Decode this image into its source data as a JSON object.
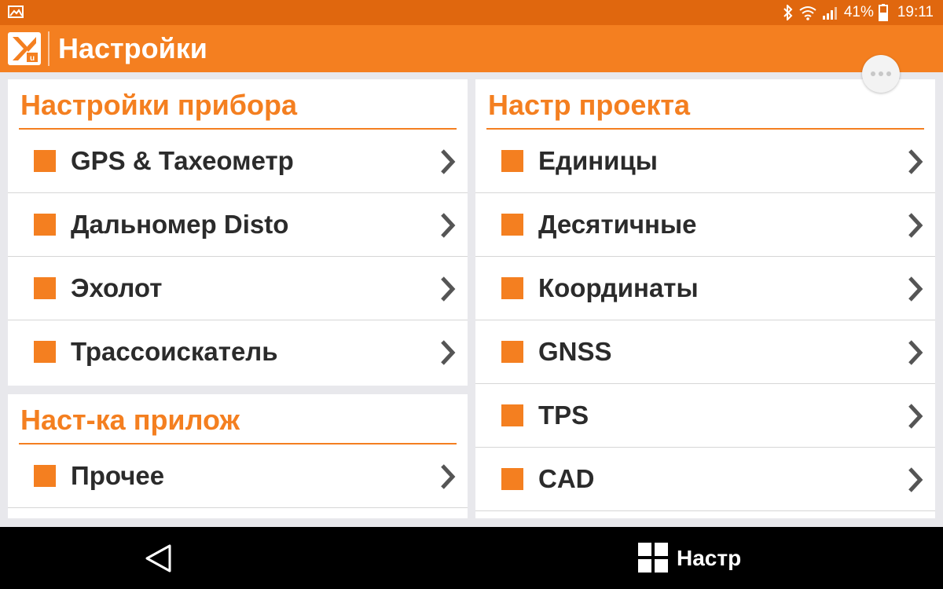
{
  "status_bar": {
    "battery": "41%",
    "time": "19:11"
  },
  "app_bar": {
    "title": "Настройки"
  },
  "device_settings": {
    "title": "Настройки прибора",
    "items": [
      {
        "label": "GPS & Тахеометр"
      },
      {
        "label": "Дальномер Disto"
      },
      {
        "label": "Эхолот"
      },
      {
        "label": "Трассоискатель"
      }
    ]
  },
  "app_settings": {
    "title": "Наст-ка прилож",
    "items": [
      {
        "label": "Прочее"
      }
    ]
  },
  "project_settings": {
    "title": "Настр проекта",
    "items": [
      {
        "label": "Единицы"
      },
      {
        "label": "Десятичные"
      },
      {
        "label": "Координаты"
      },
      {
        "label": "GNSS"
      },
      {
        "label": "TPS"
      },
      {
        "label": "CAD"
      }
    ]
  },
  "nav_bar": {
    "menu_label": "Настр"
  },
  "colors": {
    "accent": "#f47f20",
    "status_bar": "#e0670e"
  }
}
